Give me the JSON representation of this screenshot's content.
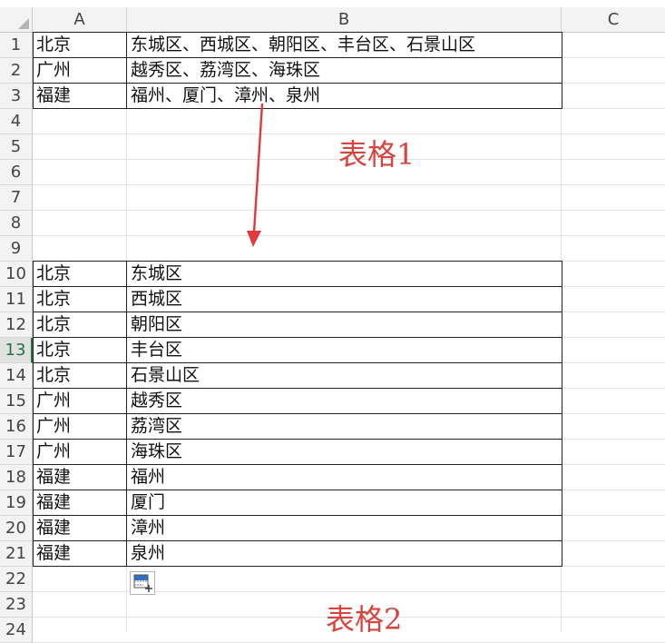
{
  "columns": [
    "A",
    "B",
    "C"
  ],
  "rows": [
    "1",
    "2",
    "3",
    "4",
    "5",
    "6",
    "7",
    "8",
    "9",
    "10",
    "11",
    "12",
    "13",
    "14",
    "15",
    "16",
    "17",
    "18",
    "19",
    "20",
    "21",
    "22",
    "23",
    "24"
  ],
  "selected_row": "13",
  "table1": [
    {
      "a": "北京",
      "b": "东城区、西城区、朝阳区、丰台区、石景山区"
    },
    {
      "a": "广州",
      "b": "越秀区、荔湾区、海珠区"
    },
    {
      "a": "福建",
      "b": "福州、厦门、漳州、泉州"
    }
  ],
  "table2": [
    {
      "a": "北京",
      "b": "东城区"
    },
    {
      "a": "北京",
      "b": "西城区"
    },
    {
      "a": "北京",
      "b": "朝阳区"
    },
    {
      "a": "北京",
      "b": "丰台区"
    },
    {
      "a": "北京",
      "b": "石景山区"
    },
    {
      "a": "广州",
      "b": "越秀区"
    },
    {
      "a": "广州",
      "b": "荔湾区"
    },
    {
      "a": "广州",
      "b": "海珠区"
    },
    {
      "a": "福建",
      "b": "福州"
    },
    {
      "a": "福建",
      "b": "厦门"
    },
    {
      "a": "福建",
      "b": "漳州"
    },
    {
      "a": "福建",
      "b": "泉州"
    }
  ],
  "labels": {
    "table1": "表格1",
    "table2": "表格2"
  },
  "colors": {
    "annotation": "#d9433e",
    "arrow": "#e03a3a",
    "selected_row": "#217346"
  },
  "icons": {
    "paste_options": "paste-options-icon",
    "arrow": "down-arrow-icon"
  }
}
